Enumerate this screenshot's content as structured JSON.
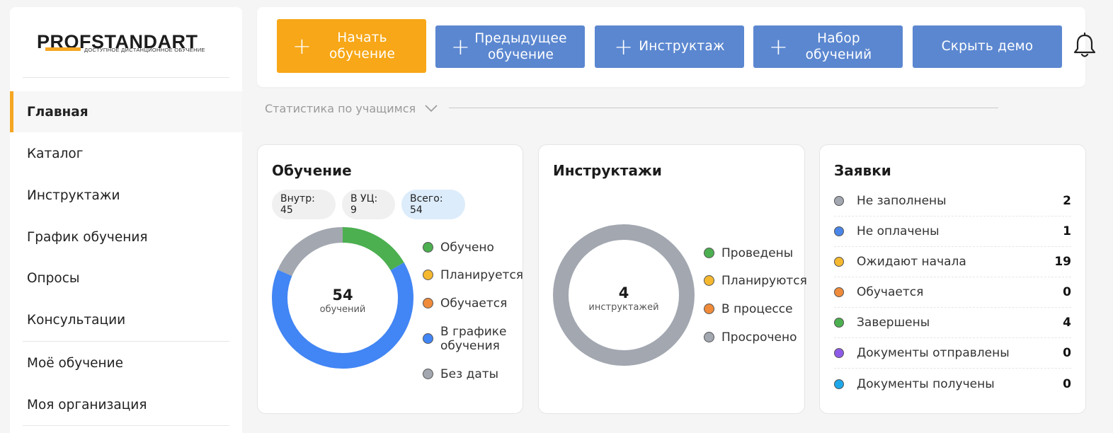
{
  "logo": {
    "main": "PROFSTANDART",
    "sub": "ДОСТУПНОЕ ДИСТАНЦИОННОЕ ОБУЧЕНИЕ"
  },
  "sidebar": {
    "items": [
      {
        "label": "Главная",
        "active": true
      },
      {
        "label": "Каталог"
      },
      {
        "label": "Инструктажи"
      },
      {
        "label": "График обучения"
      },
      {
        "label": "Опросы"
      },
      {
        "label": "Консультации"
      },
      {
        "label": "Моё обучение"
      },
      {
        "label": "Моя организация"
      }
    ]
  },
  "toolbar": {
    "start": {
      "line1": "Начать",
      "line2": "обучение"
    },
    "previous": {
      "line1": "Предыдущее",
      "line2": "обучение"
    },
    "briefing": {
      "label": "Инструктаж"
    },
    "set": {
      "line1": "Набор",
      "line2": "обучений"
    },
    "hide_demo": {
      "label": "Скрыть демо"
    },
    "bell_icon": "bell-icon"
  },
  "stats": {
    "label": "Статистика по учащимся"
  },
  "training": {
    "title": "Обучение",
    "pills": {
      "internal": "Внутр: 45",
      "center": "В УЦ: 9",
      "total": "Всего: 54"
    },
    "center_number": "54",
    "center_label": "обучений",
    "segments": [
      {
        "name": "Обучено",
        "value": 9,
        "color": "#4caf50"
      },
      {
        "name": "Планируется",
        "value": 0,
        "color": "#f5b82e"
      },
      {
        "name": "Обучается",
        "value": 0,
        "color": "#ef8b3a"
      },
      {
        "name": "В графике обучения",
        "value": 35,
        "color": "#4285f4"
      },
      {
        "name": "Без даты",
        "value": 10,
        "color": "#a2a7b0"
      }
    ],
    "legend": {
      "l1": "Обучено",
      "l2": "Планируется",
      "l3": "Обучается",
      "l4a": "В графике",
      "l4b": "обучения",
      "l5": "Без даты"
    },
    "colors": {
      "trained": "#4caf50",
      "planned": "#f5b82e",
      "learning": "#ef8b3a",
      "scheduled": "#4285f4",
      "nodate": "#a2a7b0"
    }
  },
  "briefings": {
    "title": "Инструктажи",
    "center_number": "4",
    "center_label": "инструктажей",
    "segments": [
      {
        "name": "Проведены",
        "value": 0,
        "color": "#4caf50"
      },
      {
        "name": "Планируются",
        "value": 0,
        "color": "#f5b82e"
      },
      {
        "name": "В процессе",
        "value": 0,
        "color": "#ef8b3a"
      },
      {
        "name": "Просрочено",
        "value": 4,
        "color": "#a2a7b0"
      }
    ],
    "legend": {
      "l1": "Проведены",
      "l2": "Планируются",
      "l3": "В процессе",
      "l4": "Просрочено"
    },
    "colors": {
      "done": "#4caf50",
      "planned": "#f5b82e",
      "progress": "#ef8b3a",
      "overdue": "#a2a7b0"
    }
  },
  "requests": {
    "title": "Заявки",
    "rows": [
      {
        "label": "Не заполнены",
        "value": "2",
        "color": "#a2a7b0"
      },
      {
        "label": "Не оплачены",
        "value": "1",
        "color": "#4a86e8"
      },
      {
        "label": "Ожидают начала",
        "value": "19",
        "color": "#f5b82e"
      },
      {
        "label": "Обучается",
        "value": "0",
        "color": "#ef8b3a"
      },
      {
        "label": "Завершены",
        "value": "4",
        "color": "#4caf50"
      },
      {
        "label": "Документы отправлены",
        "value": "0",
        "color": "#8e5be8"
      },
      {
        "label": "Документы получены",
        "value": "0",
        "color": "#1ea7e8"
      }
    ]
  }
}
